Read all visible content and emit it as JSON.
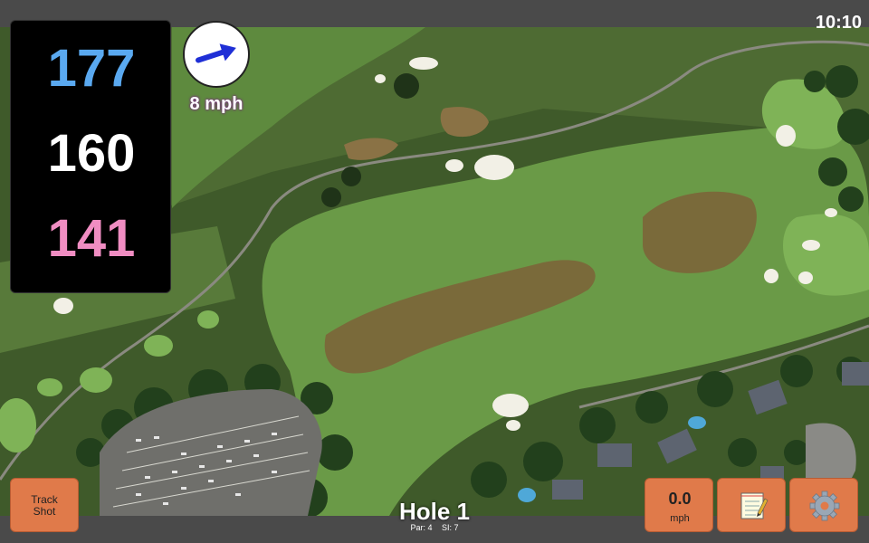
{
  "status": {
    "time": "10:10"
  },
  "distances": {
    "back": "177",
    "middle": "160",
    "front": "141"
  },
  "wind": {
    "speed_label": "8 mph",
    "direction": "east-northeast",
    "arrow_icon": "wind-arrow-icon"
  },
  "buttons": {
    "track_shot_line1": "Track",
    "track_shot_line2": "Shot",
    "wind_value": "0.0",
    "wind_unit": "mph",
    "notes_icon": "notepad-icon",
    "settings_icon": "gear-icon"
  },
  "hole": {
    "title": "Hole 1",
    "par": "Par: 4",
    "si": "SI: 7"
  },
  "colors": {
    "back": "#5aa9f0",
    "middle": "#ffffff",
    "front": "#f08dc2",
    "button": "#e07a4a",
    "accent": "#c86ad0"
  }
}
